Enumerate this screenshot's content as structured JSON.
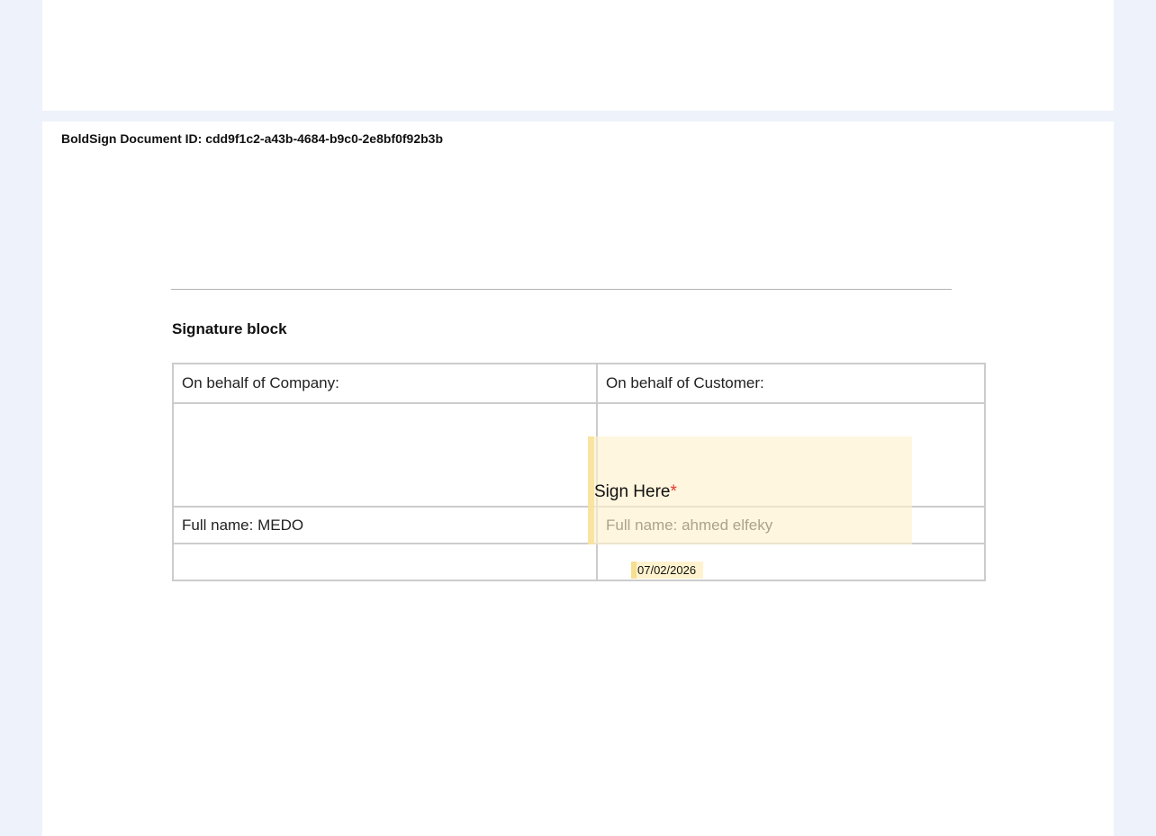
{
  "document": {
    "id_label": "BoldSign Document ID: cdd9f1c2-a43b-4684-b9c0-2e8bf0f92b3b",
    "section_title": "Signature block"
  },
  "signature_table": {
    "company_header": "On behalf of Company:",
    "customer_header": "On behalf of Customer:",
    "company_full_name": "Full name: MEDO",
    "customer_full_name": "Full name: ahmed elfeky"
  },
  "fields": {
    "sign_here_label": "Sign Here",
    "required_marker": "*",
    "date_value": "07/02/2026"
  },
  "colors": {
    "background": "#edf2fb",
    "field_fill": "#fff1cc",
    "field_accent": "#f7df92",
    "required": "#e03a2f"
  }
}
